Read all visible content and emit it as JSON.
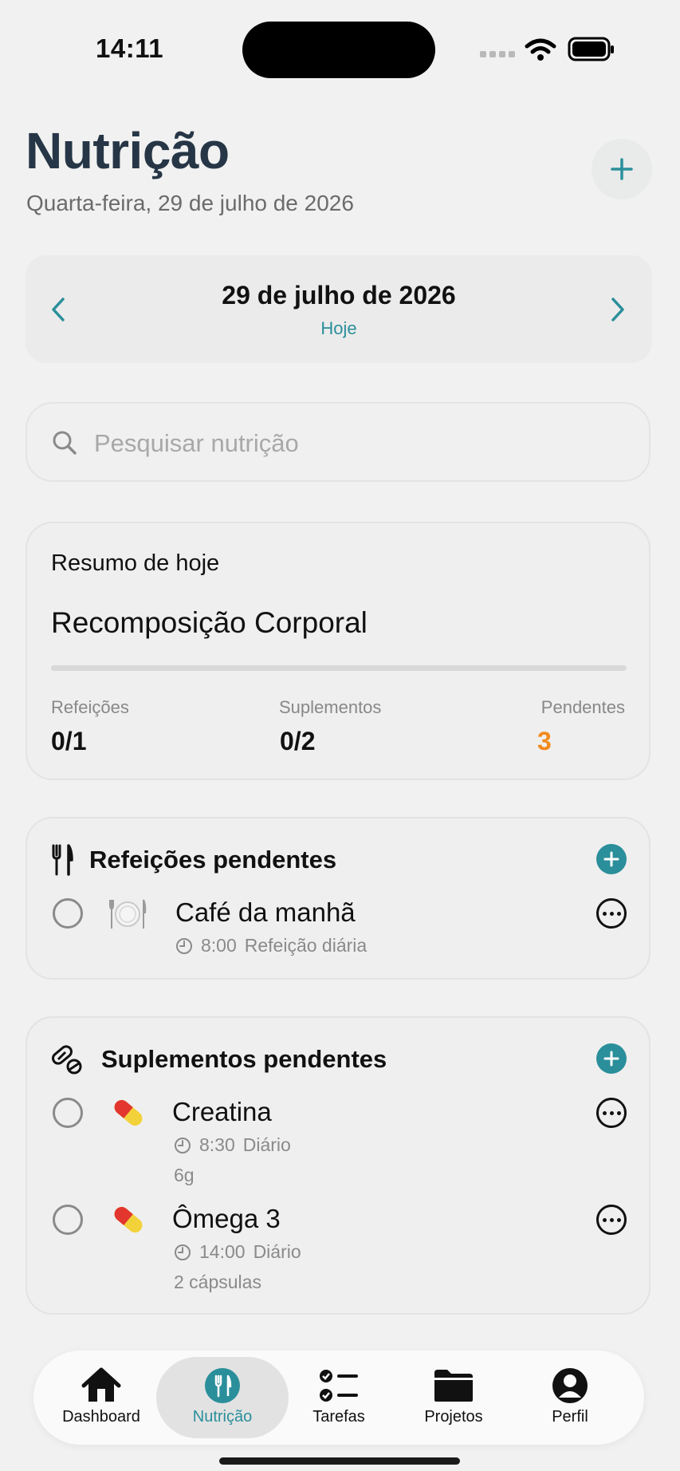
{
  "status_bar": {
    "time": "14:11"
  },
  "header": {
    "title": "Nutrição",
    "subtitle": "Quarta-feira, 29 de julho de 2026"
  },
  "date_nav": {
    "date": "29 de julho de 2026",
    "today_label": "Hoje"
  },
  "search": {
    "placeholder": "Pesquisar nutrição"
  },
  "summary": {
    "title": "Resumo de hoje",
    "goal": "Recomposição Corporal",
    "progress": 0,
    "stats": [
      {
        "label": "Refeições",
        "value": "0/1"
      },
      {
        "label": "Suplementos",
        "value": "0/2"
      },
      {
        "label": "Pendentes",
        "value": "3"
      }
    ]
  },
  "meals": {
    "title": "Refeições pendentes",
    "items": [
      {
        "name": "Café da manhã",
        "time": "8:00",
        "frequency": "Refeição diária",
        "icon": "plate-icon"
      }
    ]
  },
  "supplements": {
    "title": "Suplementos pendentes",
    "items": [
      {
        "name": "Creatina",
        "time": "8:30",
        "frequency": "Diário",
        "dose": "6g",
        "icon": "pill-icon"
      },
      {
        "name": "Ômega 3",
        "time": "14:00",
        "frequency": "Diário",
        "dose": "2 cápsulas",
        "icon": "pill-icon"
      }
    ]
  },
  "tabbar": {
    "tabs": [
      {
        "label": "Dashboard",
        "icon": "home-icon"
      },
      {
        "label": "Nutrição",
        "icon": "fork-knife-icon",
        "active": true
      },
      {
        "label": "Tarefas",
        "icon": "checklist-icon"
      },
      {
        "label": "Projetos",
        "icon": "folder-icon"
      },
      {
        "label": "Perfil",
        "icon": "person-icon"
      }
    ]
  },
  "colors": {
    "accent": "#2a8f9b",
    "title": "#263646",
    "pending": "#f28a1c"
  }
}
